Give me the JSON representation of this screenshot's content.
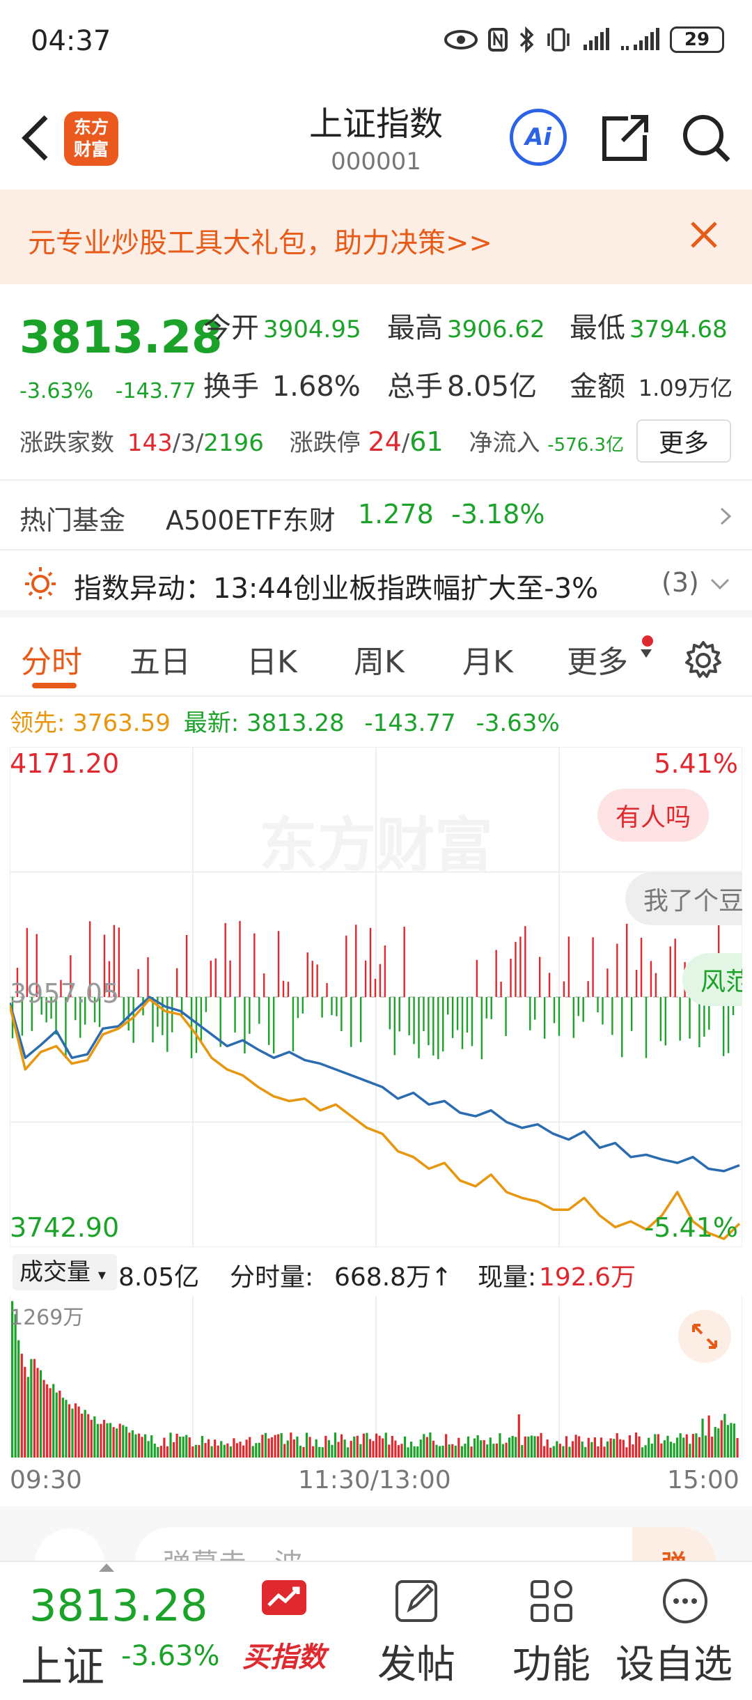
{
  "status_bar": {
    "time": "04:37",
    "battery": "29"
  },
  "header": {
    "title": "上证指数",
    "code": "000001",
    "logo_text": "东方财富",
    "ai_label": "Ai"
  },
  "banner": {
    "text": "元专业炒股工具大礼包，助力决策>>"
  },
  "quote": {
    "price": "3813.28",
    "change_pct": "-3.63%",
    "change_abs": "-143.77",
    "open_label": "今开",
    "open": "3904.95",
    "high_label": "最高",
    "high": "3906.62",
    "low_label": "最低",
    "low": "3794.68",
    "turnover_label": "换手",
    "turnover": "1.68%",
    "volume_label": "总手",
    "volume": "8.05亿",
    "amount_label": "金额",
    "amount": "1.09万亿",
    "breadth_label": "涨跌家数",
    "up": "143",
    "flat": "3",
    "down": "2196",
    "limit_label": "涨跌停",
    "limit_up": "24",
    "limit_down": "61",
    "netflow_label": "净流入",
    "netflow": "-576.3亿",
    "more_label": "更多"
  },
  "hot_fund": {
    "label": "热门基金",
    "name": "A500ETF东财",
    "price": "1.278",
    "pct": "-3.18%"
  },
  "alert": {
    "text": "指数异动：13:44创业板指跌幅扩大至-3%",
    "count": "(3)"
  },
  "tabs": [
    {
      "label": "分时",
      "active": true
    },
    {
      "label": "五日",
      "active": false
    },
    {
      "label": "日K",
      "active": false
    },
    {
      "label": "周K",
      "active": false
    },
    {
      "label": "月K",
      "active": false
    },
    {
      "label": "更多",
      "active": false
    }
  ],
  "lead_row": {
    "lead_label": "领先:",
    "lead_value": "3763.59",
    "latest_label": "最新:",
    "latest_value": "3813.28",
    "change_abs": "-143.77",
    "change_pct": "-3.63%"
  },
  "chart": {
    "y_max_label": "4171.20",
    "y_min_label": "3742.90",
    "y_mid_label": "3957.05",
    "pct_max_label": "5.41%",
    "pct_min_label": "-5.41%",
    "watermark": "东方财富",
    "danmu": [
      "有人吗",
      "我了个豆",
      "风范"
    ],
    "colors": {
      "up": "#e0292f",
      "down": "#1aa229",
      "price_line": "#2b6cb0",
      "avg_line": "#e8960d"
    }
  },
  "chart_data": {
    "type": "line",
    "x_range": [
      "09:30",
      "15:00"
    ],
    "ylim": [
      3742.9,
      4171.2
    ],
    "prev_close": 3957.05,
    "series": [
      {
        "name": "最新",
        "values": [
          3952,
          3905,
          3916,
          3928,
          3905,
          3908,
          3930,
          3932,
          3945,
          3957,
          3949,
          3945,
          3935,
          3925,
          3915,
          3920,
          3912,
          3905,
          3910,
          3903,
          3900,
          3895,
          3890,
          3885,
          3880,
          3870,
          3875,
          3865,
          3868,
          3858,
          3855,
          3860,
          3850,
          3845,
          3848,
          3840,
          3835,
          3842,
          3828,
          3832,
          3820,
          3822,
          3818,
          3815,
          3820,
          3810,
          3808,
          3813
        ]
      },
      {
        "name": "领先",
        "values": [
          3950,
          3895,
          3910,
          3915,
          3900,
          3903,
          3925,
          3930,
          3940,
          3955,
          3945,
          3942,
          3925,
          3905,
          3895,
          3890,
          3880,
          3872,
          3868,
          3870,
          3860,
          3865,
          3855,
          3845,
          3840,
          3825,
          3820,
          3810,
          3815,
          3800,
          3795,
          3805,
          3790,
          3785,
          3782,
          3775,
          3775,
          3785,
          3770,
          3760,
          3765,
          3758,
          3770,
          3790,
          3765,
          3755,
          3750,
          3763
        ]
      }
    ],
    "volume_ylabel": "1269万"
  },
  "volume": {
    "selector": "成交量",
    "total": "8.05亿",
    "minute_label": "分时量:",
    "minute_value": "668.8万↑",
    "now_label": "现量:",
    "now_value": "192.6万",
    "max_label": "1269万"
  },
  "time_axis": {
    "start": "09:30",
    "mid": "11:30/13:00",
    "end": "15:00"
  },
  "comment": {
    "placeholder": "弹幕走一波",
    "danmu_btn": "弹"
  },
  "bottom_bar": {
    "price": "3813.28",
    "name": "上证",
    "pct": "-3.63%",
    "buy_label": "买指数",
    "post_label": "发帖",
    "func_label": "功能",
    "watch_label": "设自选"
  }
}
